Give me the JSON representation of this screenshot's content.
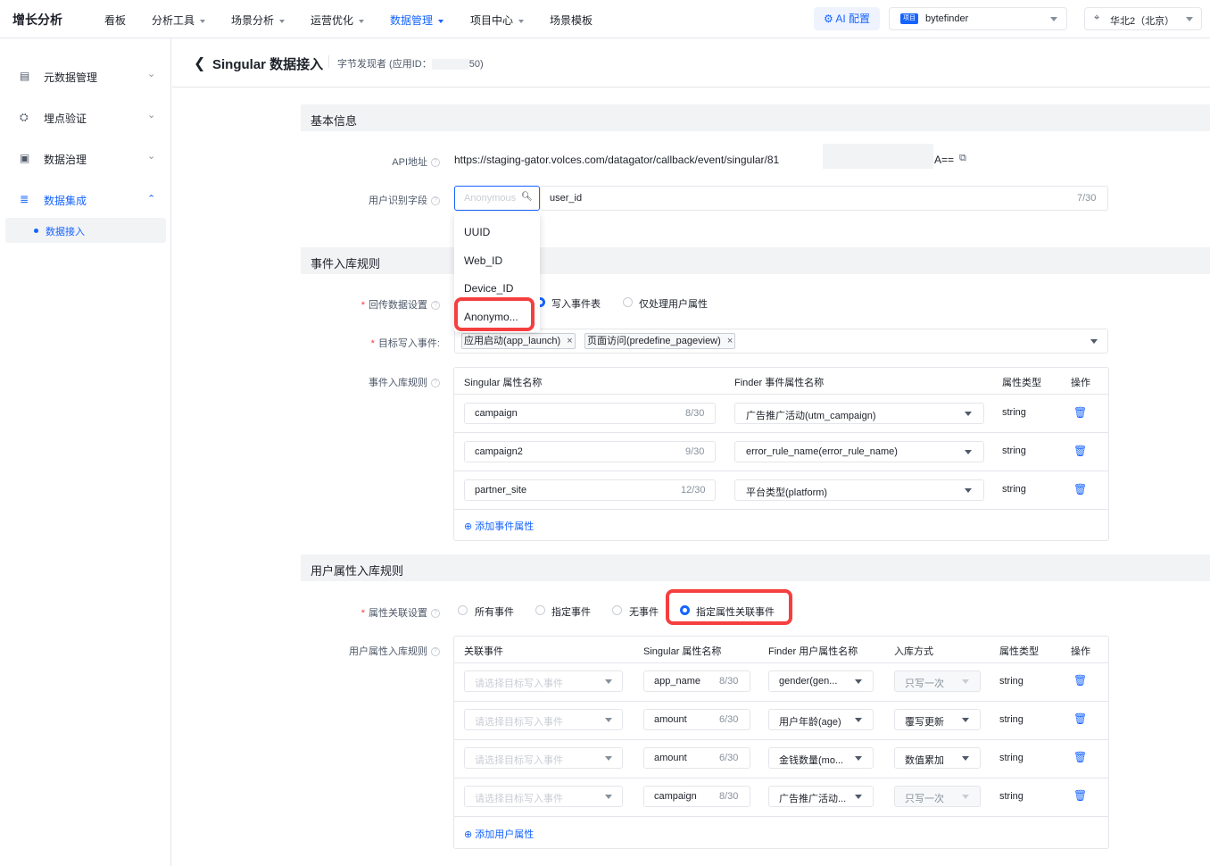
{
  "topnav": {
    "logo": "增长分析",
    "items": [
      "看板",
      "分析工具",
      "场景分析",
      "运营优化",
      "数据管理",
      "项目中心",
      "场景模板"
    ],
    "ai_label": "AI 配置",
    "project_tag": "项目",
    "project_name": "bytefinder",
    "region": "华北2（北京）"
  },
  "sidebar": {
    "items": [
      "元数据管理",
      "埋点验证",
      "数据治理",
      "数据集成"
    ],
    "sub_item": "数据接入"
  },
  "header": {
    "title": "Singular 数据接入",
    "subtitle_prefix": "字节发现者 (应用ID：",
    "subtitle_suffix": "50)"
  },
  "basic": {
    "section_title": "基本信息",
    "api_label": "API地址",
    "api_url": "https://staging-gator.volces.com/datagator/callback/event/singular/81",
    "api_tail": "A==",
    "user_id_label": "用户识别字段",
    "user_id_placeholder": "Anonymous",
    "user_id_value": "user_id",
    "user_id_counter": "7/30",
    "dropdown_options": [
      "UUID",
      "Web_ID",
      "Device_ID",
      "Anonymo..."
    ]
  },
  "event_rules": {
    "section_title": "事件入库规则",
    "backfill_label": "回传数据设置",
    "backfill_options": [
      "写入事件表",
      "仅处理用户属性"
    ],
    "target_label": "目标写入事件:",
    "target_tags": [
      "应用启动(app_launch)",
      "页面访问(predefine_pageview)"
    ],
    "rules_label": "事件入库规则",
    "columns": [
      "Singular 属性名称",
      "Finder 事件属性名称",
      "属性类型",
      "操作"
    ],
    "rows": [
      {
        "name": "campaign",
        "counter": "8/30",
        "finder": "广告推广活动(utm_campaign)",
        "type": "string"
      },
      {
        "name": "campaign2",
        "counter": "9/30",
        "finder": "error_rule_name(error_rule_name)",
        "type": "string"
      },
      {
        "name": "partner_site",
        "counter": "12/30",
        "finder": "平台类型(platform)",
        "type": "string"
      }
    ],
    "add_label": "添加事件属性"
  },
  "user_rules": {
    "section_title": "用户属性入库规则",
    "assoc_label": "属性关联设置",
    "assoc_options": [
      "所有事件",
      "指定事件",
      "无事件",
      "指定属性关联事件"
    ],
    "rules_label": "用户属性入库规则",
    "columns": [
      "关联事件",
      "Singular 属性名称",
      "Finder 用户属性名称",
      "入库方式",
      "属性类型",
      "操作"
    ],
    "rows": [
      {
        "event": "请选择目标写入事件",
        "name": "app_name",
        "counter": "8/30",
        "finder": "gender(gen...",
        "mode": "只写一次",
        "type": "string"
      },
      {
        "event": "请选择目标写入事件",
        "name": "amount",
        "counter": "6/30",
        "finder": "用户年龄(age)",
        "mode": "覆写更新",
        "type": "string"
      },
      {
        "event": "请选择目标写入事件",
        "name": "amount",
        "counter": "6/30",
        "finder": "金钱数量(mo...",
        "mode": "数值累加",
        "type": "string"
      },
      {
        "event": "请选择目标写入事件",
        "name": "campaign",
        "counter": "8/30",
        "finder": "广告推广活动...",
        "mode": "只写一次",
        "type": "string"
      }
    ],
    "add_label": "添加用户属性"
  },
  "colors": {
    "primary": "#1664ff",
    "highlight": "#f53f3f",
    "section_bg": "#f2f3f5"
  }
}
